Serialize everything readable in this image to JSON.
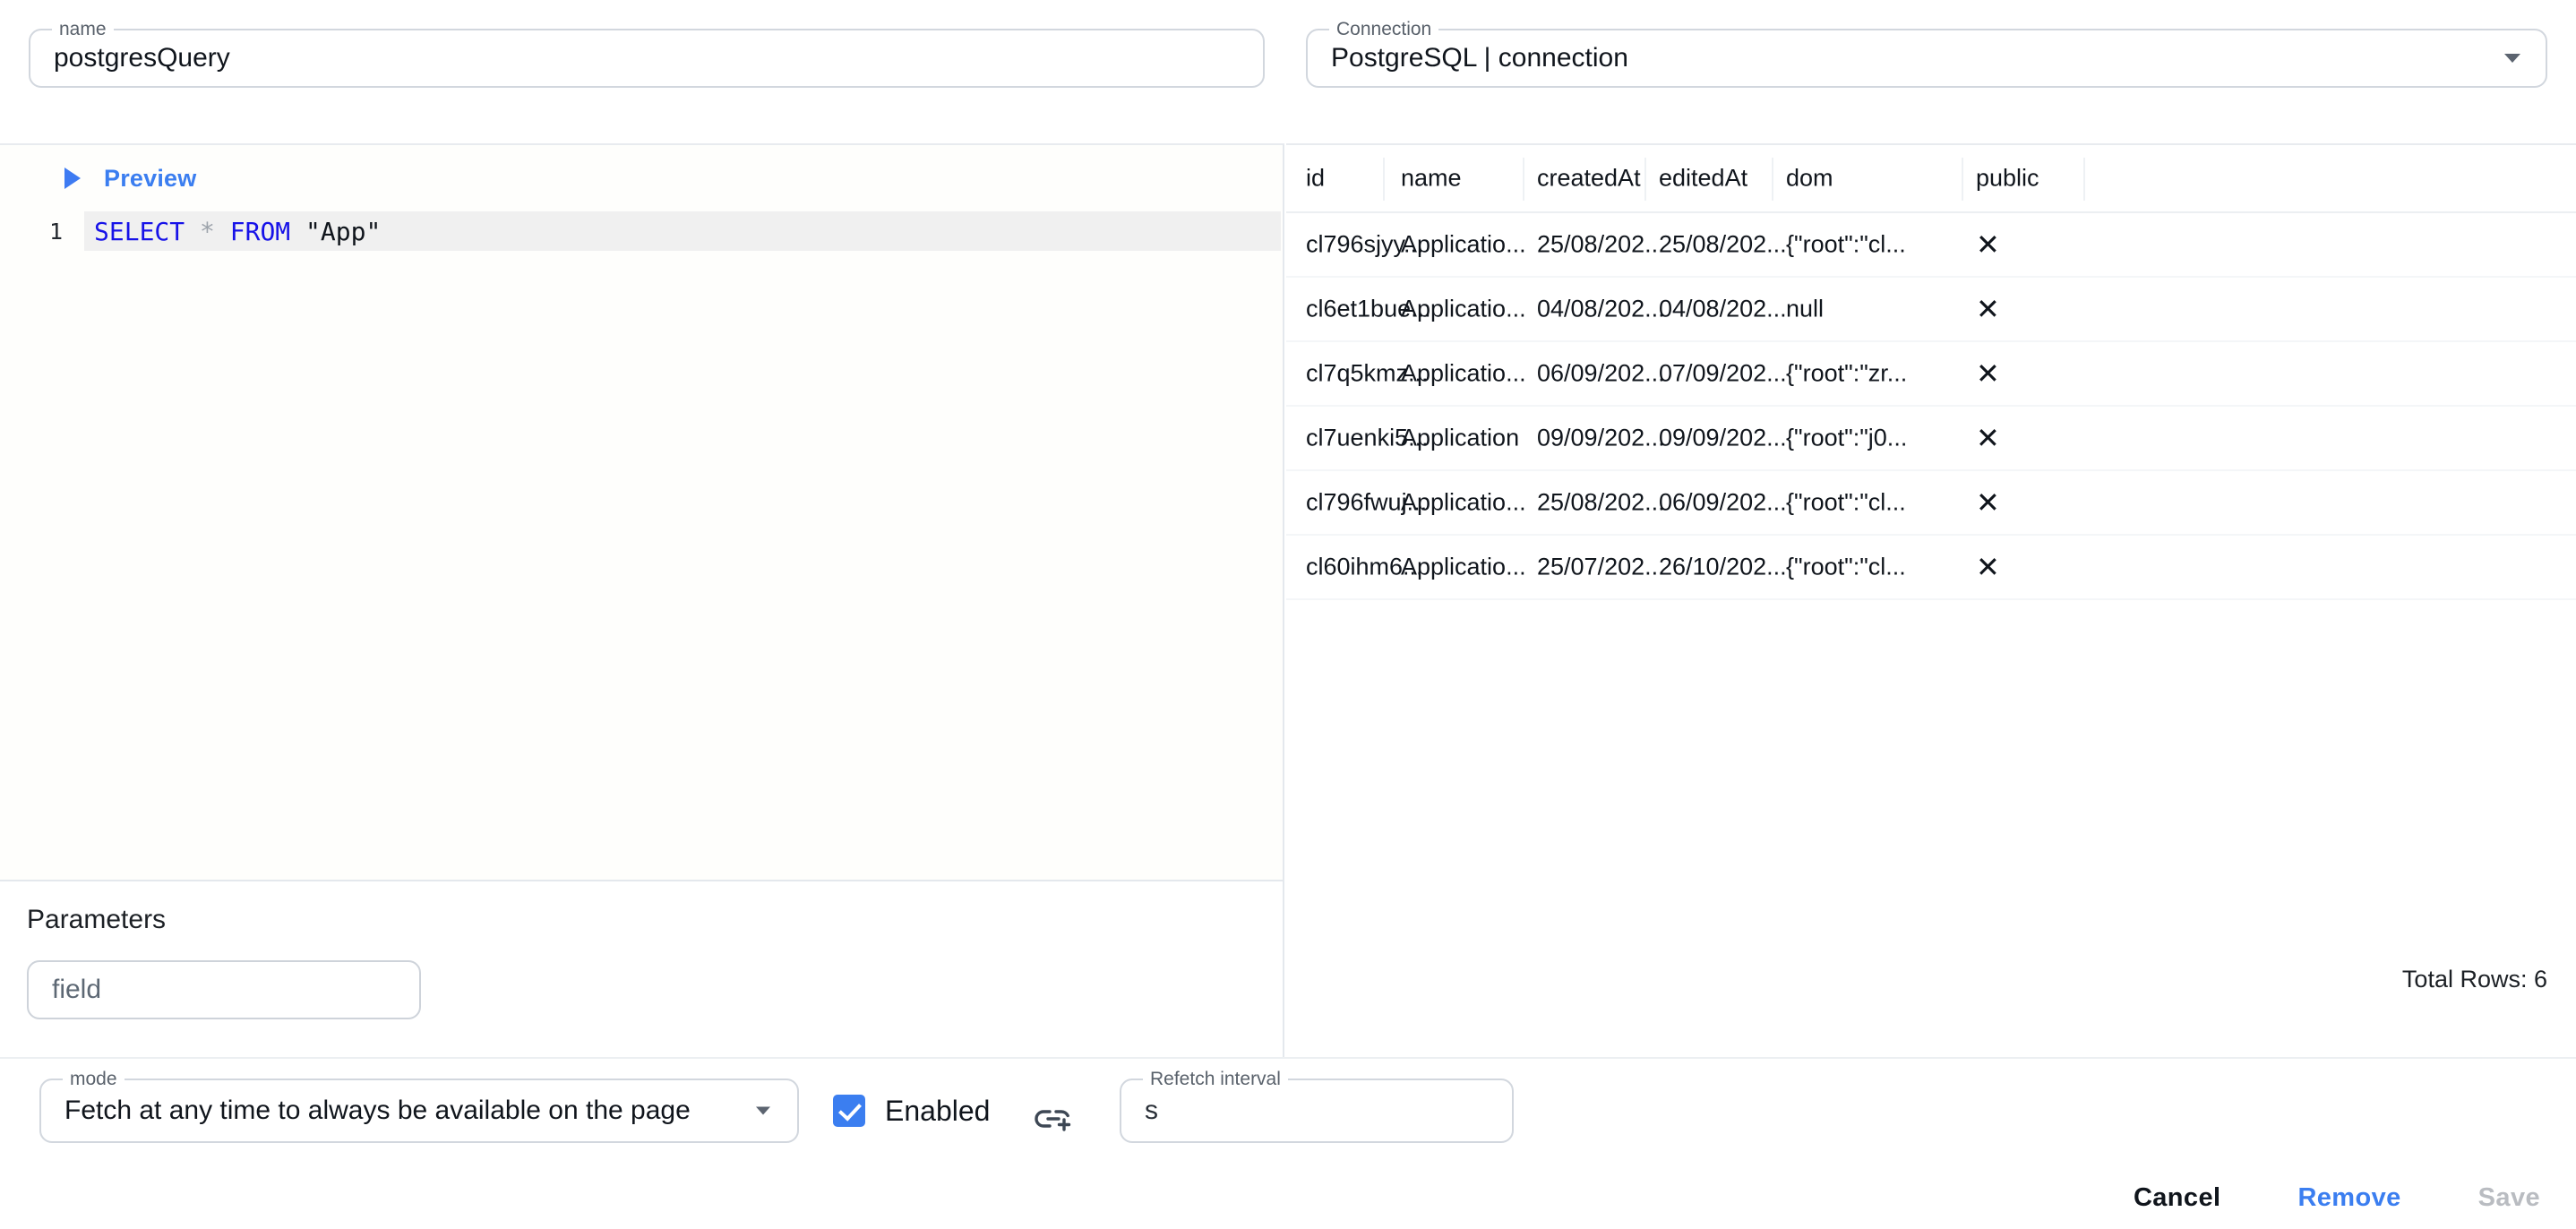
{
  "name_field": {
    "legend": "name",
    "value": "postgresQuery"
  },
  "connection_field": {
    "legend": "Connection",
    "value": "PostgreSQL | connection",
    "caret_icon": "chevron-down-icon"
  },
  "editor": {
    "preview_label": "Preview",
    "preview_toggle_icon": "triangle-right-icon",
    "lines": [
      {
        "number": "1",
        "tokens": [
          {
            "text": "SELECT",
            "type": "keyword"
          },
          {
            "text": " ",
            "type": "plain"
          },
          {
            "text": "*",
            "type": "star"
          },
          {
            "text": " ",
            "type": "plain"
          },
          {
            "text": "FROM",
            "type": "keyword"
          },
          {
            "text": " ",
            "type": "plain"
          },
          {
            "text": "\"App\"",
            "type": "string"
          }
        ]
      }
    ]
  },
  "parameters": {
    "title": "Parameters",
    "field_placeholder": "field"
  },
  "results": {
    "columns": [
      "id",
      "name",
      "createdAt",
      "editedAt",
      "dom",
      "public"
    ],
    "rows": [
      {
        "id": "cl796sjyy...",
        "name": "Applicatio...",
        "createdAt": "25/08/202...",
        "editedAt": "25/08/202...",
        "dom": "{\"root\":\"cl...",
        "public": "x-icon"
      },
      {
        "id": "cl6et1bue...",
        "name": "Applicatio...",
        "createdAt": "04/08/202...",
        "editedAt": "04/08/202...",
        "dom": "null",
        "public": "x-icon"
      },
      {
        "id": "cl7q5kmz...",
        "name": "Applicatio...",
        "createdAt": "06/09/202...",
        "editedAt": "07/09/202...",
        "dom": "{\"root\":\"zr...",
        "public": "x-icon"
      },
      {
        "id": "cl7uenki5...",
        "name": "Application",
        "createdAt": "09/09/202...",
        "editedAt": "09/09/202...",
        "dom": "{\"root\":\"j0...",
        "public": "x-icon"
      },
      {
        "id": "cl796fwuj...",
        "name": "Applicatio...",
        "createdAt": "25/08/202...",
        "editedAt": "06/09/202...",
        "dom": "{\"root\":\"cl...",
        "public": "x-icon"
      },
      {
        "id": "cl60ihm6...",
        "name": "Applicatio...",
        "createdAt": "25/07/202...",
        "editedAt": "26/10/202...",
        "dom": "{\"root\":\"cl...",
        "public": "x-icon"
      }
    ],
    "total_rows_text": "Total Rows: 6"
  },
  "controls": {
    "mode": {
      "legend": "mode",
      "value": "Fetch at any time to always be available on the page",
      "caret_icon": "chevron-down-icon"
    },
    "enabled": {
      "label": "Enabled",
      "checked": true,
      "check_icon": "checkmark-icon"
    },
    "link_icon": "add-link-icon",
    "refetch": {
      "legend": "Refetch interval",
      "value": "s"
    }
  },
  "footer": {
    "cancel_label": "Cancel",
    "remove_label": "Remove",
    "save_label": "Save"
  },
  "colors": {
    "accent": "#3b7ef0",
    "keyword": "#1712e8",
    "muted": "#9b9b9b",
    "disabled": "#b9bcc1"
  }
}
